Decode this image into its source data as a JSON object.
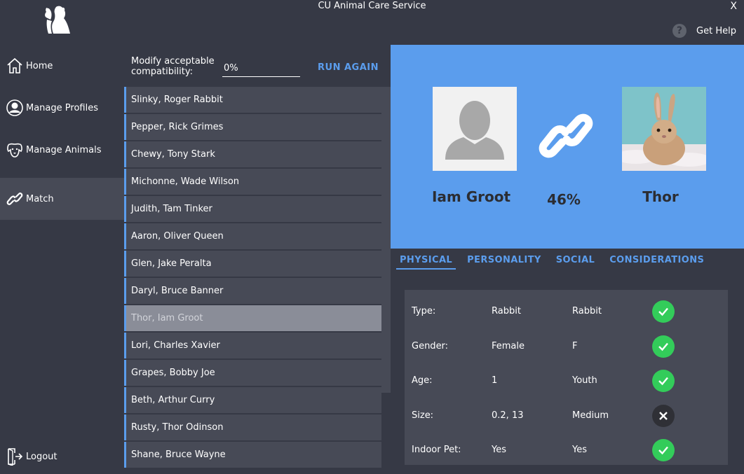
{
  "window": {
    "title": "CU Animal Care Service",
    "close_label": "X"
  },
  "help": {
    "icon_glyph": "?",
    "label": "Get Help"
  },
  "sidebar": {
    "items": [
      {
        "label": "Home",
        "icon": "home-icon"
      },
      {
        "label": "Manage Profiles",
        "icon": "person-icon"
      },
      {
        "label": "Manage Animals",
        "icon": "dog-face-icon"
      },
      {
        "label": "Match",
        "icon": "link-icon",
        "active": true
      }
    ],
    "logout_label": "Logout"
  },
  "modify": {
    "label": "Modify acceptable compatibility:",
    "value": "0%",
    "run_label": "RUN AGAIN"
  },
  "matches": [
    "Slinky, Roger Rabbit",
    "Pepper, Rick Grimes",
    "Chewy, Tony Stark",
    "Michonne, Wade Wilson",
    "Judith, Tam Tinker",
    "Aaron, Oliver Queen",
    "Glen, Jake Peralta",
    "Daryl, Bruce Banner",
    "Thor, Iam Groot",
    "Lori, Charles Xavier",
    "Grapes, Bobby Joe",
    "Beth, Arthur Curry",
    "Rusty, Thor Odinson",
    "Shane, Bruce Wayne"
  ],
  "selected_match": "Thor, Iam Groot",
  "hero": {
    "person_name": "Iam Groot",
    "percent": "46%",
    "animal_name": "Thor"
  },
  "tabs": [
    {
      "label": "PHYSICAL",
      "active": true
    },
    {
      "label": "PERSONALITY"
    },
    {
      "label": "SOCIAL"
    },
    {
      "label": "CONSIDERATIONS"
    }
  ],
  "physical": [
    {
      "label": "Type:",
      "a": "Rabbit",
      "b": "Rabbit",
      "match": true
    },
    {
      "label": "Gender:",
      "a": "Female",
      "b": "F",
      "match": true
    },
    {
      "label": "Age:",
      "a": "1",
      "b": "Youth",
      "match": true
    },
    {
      "label": "Size:",
      "a": "0.2, 13",
      "b": "Medium",
      "match": false
    },
    {
      "label": "Indoor Pet:",
      "a": "Yes",
      "b": "Yes",
      "match": true
    }
  ],
  "colors": {
    "accent": "#5b9ded",
    "success": "#33cc5a",
    "background": "#363945",
    "panel": "#474a56"
  }
}
